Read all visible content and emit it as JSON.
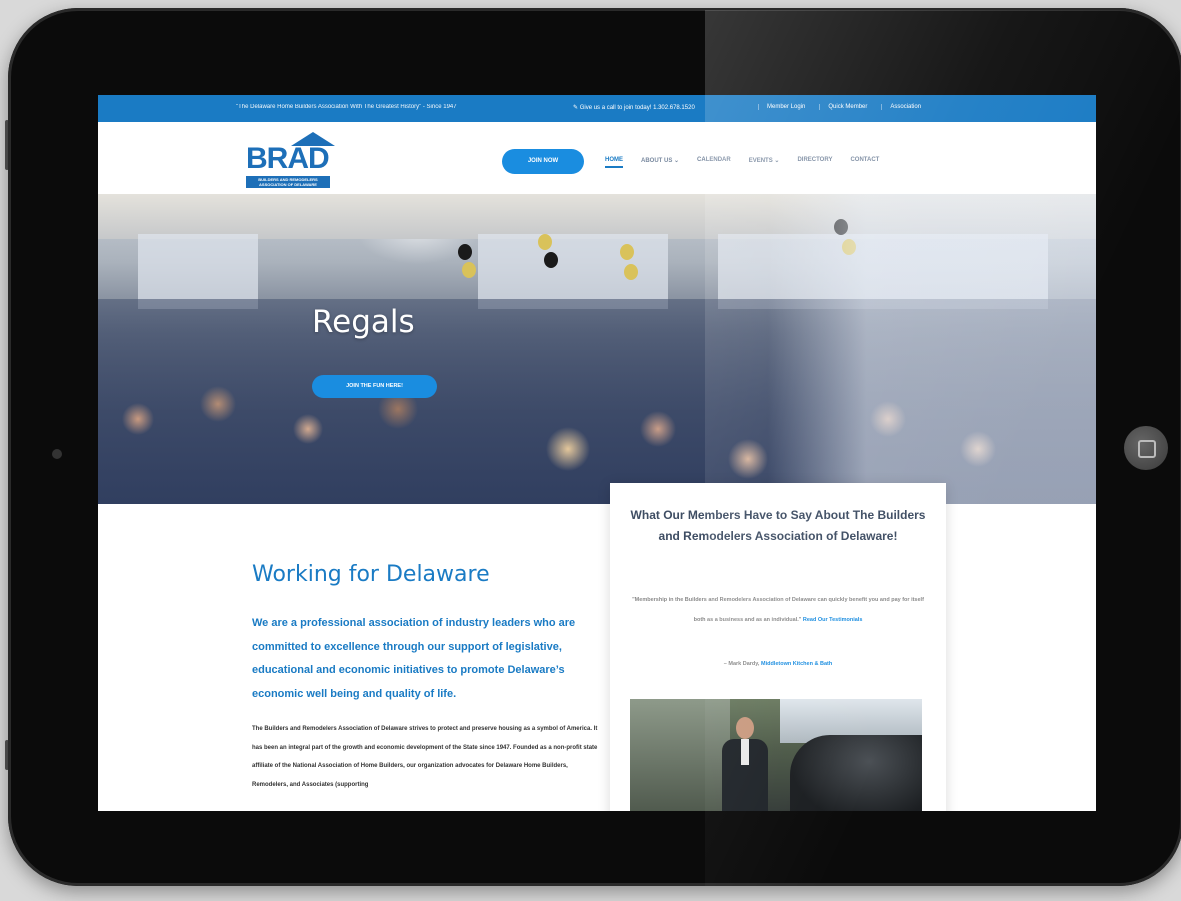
{
  "topbar": {
    "tagline": "\"The Delaware Home Builders Association With The Greatest History\" - Since 1947",
    "call": "Give us a call to join today! 1.302.678.1520",
    "links": [
      "Member Login",
      "Quick Member",
      "Association"
    ]
  },
  "header": {
    "logo_text": "BRAD",
    "logo_sub_line1": "BUILDERS AND REMODELERS",
    "logo_sub_line2": "ASSOCIATION OF DELAWARE",
    "join_button": "JOIN NOW",
    "nav": [
      "HOME",
      "ABOUT US",
      "CALENDAR",
      "EVENTS",
      "DIRECTORY",
      "CONTACT"
    ]
  },
  "hero": {
    "title": "Regals",
    "button": "JOIN THE FUN HERE!"
  },
  "main": {
    "title": "Working for Delaware",
    "lead": "We are a professional association of industry leaders who are committed to excellence through our support of legislative, educational and economic initiatives to promote Delaware’s economic well being and quality of life.",
    "body": "The Builders and Remodelers Association of Delaware strives to protect and preserve housing as a symbol of America. It has been an integral part of the growth and economic development of the State since 1947. Founded as a non-profit state affiliate of the National Association of Home Builders, our organization advocates for Delaware Home Builders, Remodelers, and Associates (supporting"
  },
  "testimonial": {
    "title": "What Our Members Have to Say About The Builders and Remodelers Association of Delaware!",
    "quote": "\"Membership in the Builders and Remodelers Association of Delaware can quickly benefit you and pay for itself both as a business and as an individual.\"",
    "read_more": "Read Our Testimonials",
    "author_prefix": "– Mark Dardy,",
    "author_company": "Middletown Kitchen & Bath"
  },
  "colors": {
    "brand_blue": "#1a7bc4",
    "button_blue": "#1a8de0",
    "balloon_gold": "#d9c25a",
    "balloon_black": "#1a1a1a"
  }
}
